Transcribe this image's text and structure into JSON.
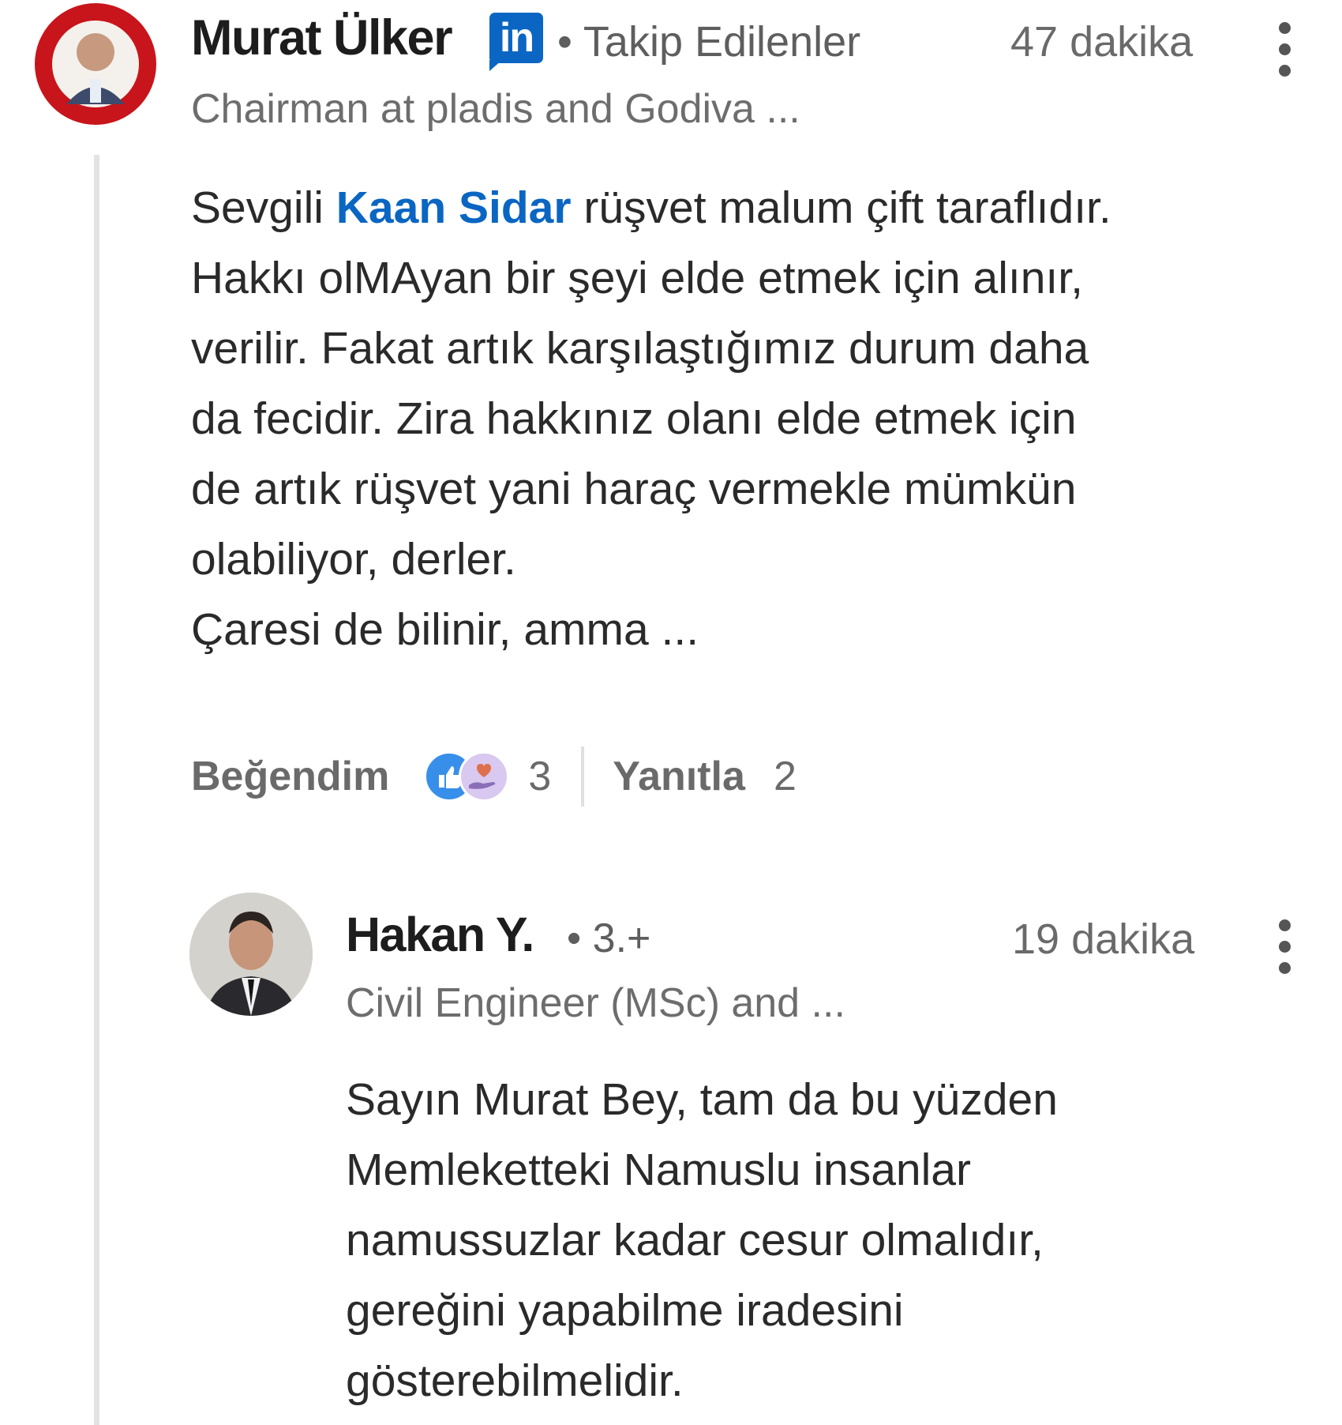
{
  "comment": {
    "author": "Murat Ülker",
    "linkedin_badge": "in",
    "follow_status": "• Takip Edilenler",
    "time": "47 dakika",
    "headline": "Chairman at pladis and Godiva ...",
    "body": {
      "line1_prefix": "Sevgili ",
      "mention": "Kaan Sidar",
      "line1_suffix": " rüşvet malum çift taraflıdır.",
      "lines": [
        "Hakkı olMAyan bir şeyi elde etmek için alınır,",
        "verilir. Fakat artık karşılaştığımız durum daha",
        "da fecidir. Zira hakkınız olanı elde etmek için",
        "de artık rüşvet yani haraç vermekle mümkün",
        "olabiliyor, derler.",
        "Çaresi de bilinir, amma ..."
      ]
    },
    "actions": {
      "like_label": "Beğendim",
      "reaction_count": "3",
      "reply_label": "Yanıtla",
      "reply_count": "2"
    },
    "reactions": [
      "like-icon",
      "support-icon"
    ]
  },
  "reply": {
    "author": "Hakan Y.",
    "degree": "• 3.+",
    "time": "19 dakika",
    "headline": "Civil Engineer (MSc) and ...",
    "lines": [
      "Sayın Murat Bey, tam da bu yüzden",
      "Memleketteki Namuslu insanlar",
      "namussuzlar kadar cesur olmalıdır,",
      "gereğini yapabilme iradesini",
      "gösterebilmelidir."
    ]
  },
  "colors": {
    "linkedin_blue": "#0a66c2",
    "mention": "#0a66c2",
    "avatar_ring": "#c8141b"
  }
}
